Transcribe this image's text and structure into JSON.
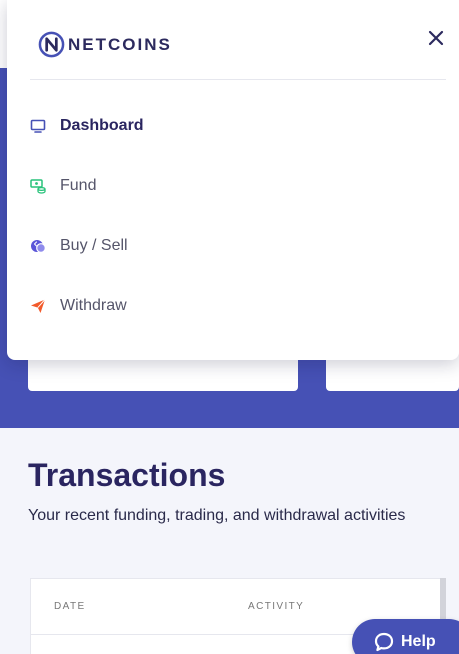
{
  "brand": {
    "name": "NETCOINS",
    "color": "#2c2a5e",
    "accent": "#4651b5"
  },
  "nav": {
    "items": [
      {
        "id": "dashboard",
        "label": "Dashboard",
        "icon": "monitor-icon",
        "active": true,
        "icon_color": "#4651b5"
      },
      {
        "id": "fund",
        "label": "Fund",
        "icon": "fund-icon",
        "active": false,
        "icon_color": "#27c27a"
      },
      {
        "id": "buy-sell",
        "label": "Buy / Sell",
        "icon": "exchange-icon",
        "active": false,
        "icon_color": "#5a55d8"
      },
      {
        "id": "withdraw",
        "label": "Withdraw",
        "icon": "send-icon",
        "active": false,
        "icon_color": "#f25a2b"
      }
    ]
  },
  "transactions": {
    "title": "Transactions",
    "subtitle": "Your recent funding, trading, and withdrawal activities",
    "columns": [
      "DATE",
      "ACTIVITY"
    ]
  },
  "help": {
    "label": "Help"
  }
}
